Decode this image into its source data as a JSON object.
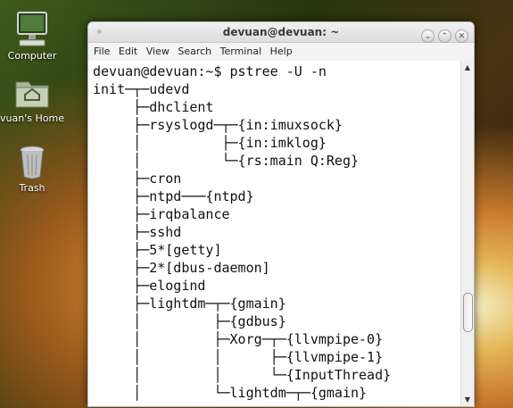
{
  "desktop": {
    "icons": [
      {
        "label": "Computer",
        "icon": "computer-icon"
      },
      {
        "label": "vuan's Home",
        "icon": "home-folder-icon"
      },
      {
        "label": "Trash",
        "icon": "trash-icon"
      }
    ]
  },
  "window": {
    "title": "devuan@devuan: ~",
    "menu": [
      "File",
      "Edit",
      "View",
      "Search",
      "Terminal",
      "Help"
    ]
  },
  "terminal": {
    "lines": [
      "devuan@devuan:~$ pstree -U -n",
      "init─┬─udevd",
      "     ├─dhclient",
      "     ├─rsyslogd─┬─{in:imuxsock}",
      "     │          ├─{in:imklog}",
      "     │          └─{rs:main Q:Reg}",
      "     ├─cron",
      "     ├─ntpd───{ntpd}",
      "     ├─irqbalance",
      "     ├─sshd",
      "     ├─5*[getty]",
      "     ├─2*[dbus-daemon]",
      "     ├─elogind",
      "     ├─lightdm─┬─{gmain}",
      "     │         ├─{gdbus}",
      "     │         ├─Xorg─┬─{llvmpipe-0}",
      "     │         │      ├─{llvmpipe-1}",
      "     │         │      └─{InputThread}",
      "     │         └─lightdm─┬─{gmain}"
    ]
  }
}
